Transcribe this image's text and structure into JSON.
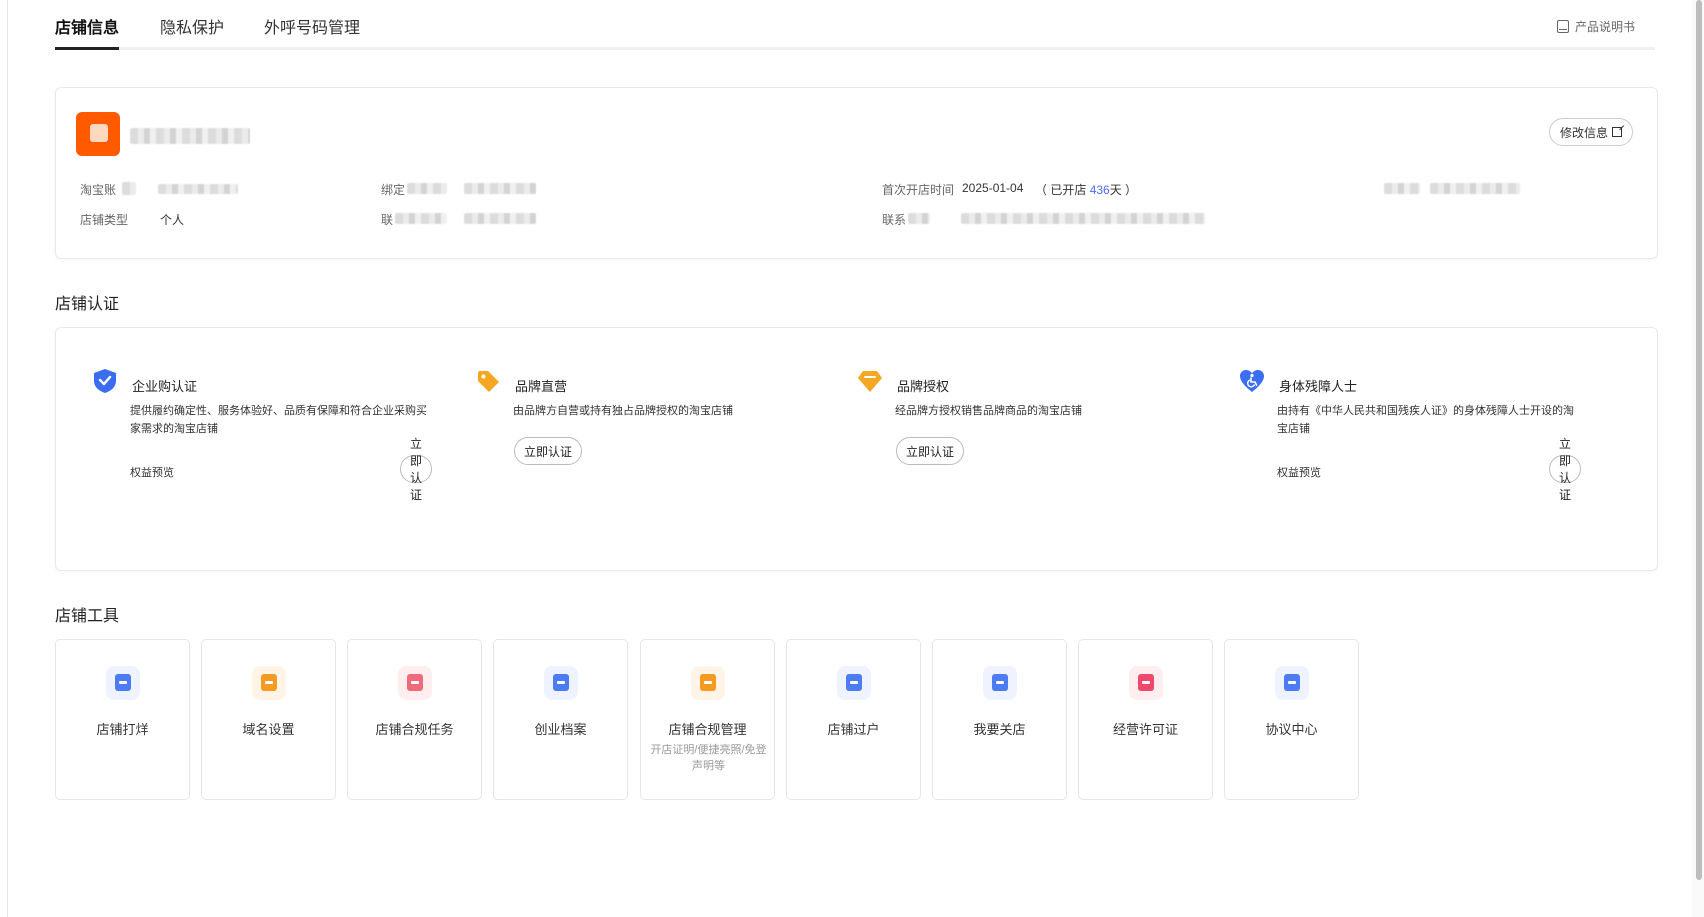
{
  "tabs": [
    {
      "label": "店铺信息",
      "active": true
    },
    {
      "label": "隐私保护",
      "active": false
    },
    {
      "label": "外呼号码管理",
      "active": false
    }
  ],
  "manual_link": "产品说明书",
  "store": {
    "edit_button": "修改信息",
    "fields": {
      "account_label": "淘宝账",
      "bind_label": "绑定",
      "first_open_label": "首次开店时间",
      "first_open_date": "2025-01-04",
      "open_prefix": "（ 已开店",
      "open_days": "436",
      "open_suffix": "天 ）",
      "type_label": "店铺类型",
      "type_value": "个人",
      "contact_label_1": "联",
      "contact_label_2": "联系"
    }
  },
  "cert_section_title": "店铺认证",
  "certs": [
    {
      "title": "企业购认证",
      "desc": "提供履约确定性、服务体验好、品质有保障和符合企业采购买家需求的淘宝店铺",
      "benefit": "权益预览",
      "button": "立即认证",
      "icon": "shield-check-icon",
      "color": "#3a6df0"
    },
    {
      "title": "品牌直营",
      "desc": "由品牌方自营或持有独占品牌授权的淘宝店铺",
      "benefit": "",
      "button": "立即认证",
      "icon": "tag-icon",
      "color": "#f5a623"
    },
    {
      "title": "品牌授权",
      "desc": "经品牌方授权销售品牌商品的淘宝店铺",
      "benefit": "",
      "button": "立即认证",
      "icon": "diamond-icon",
      "color": "#f5a623"
    },
    {
      "title": "身体残障人士",
      "desc": "由持有《中华人民共和国残疾人证》的身体残障人士开设的淘宝店铺",
      "benefit": "权益预览",
      "button": "立即认证",
      "icon": "heart-wheelchair-icon",
      "color": "#3a6df0"
    }
  ],
  "tools_section_title": "店铺工具",
  "tools": [
    {
      "label": "店铺打烊",
      "sub": "",
      "icon": "store-close-icon",
      "color": "#4b7cf3"
    },
    {
      "label": "域名设置",
      "sub": "",
      "icon": "domain-icon",
      "color": "#f59a23"
    },
    {
      "label": "店铺合规任务",
      "sub": "",
      "icon": "compliance-shield-icon",
      "color": "#f06a7b"
    },
    {
      "label": "创业档案",
      "sub": "",
      "icon": "archive-icon",
      "color": "#4b7cf3"
    },
    {
      "label": "店铺合规管理",
      "sub": "开店证明/便捷亮照/免登声明等",
      "icon": "compliance-doc-icon",
      "color": "#f59a23"
    },
    {
      "label": "店铺过户",
      "sub": "",
      "icon": "transfer-icon",
      "color": "#4b7cf3"
    },
    {
      "label": "我要关店",
      "sub": "",
      "icon": "close-store-icon",
      "color": "#4b7cf3"
    },
    {
      "label": "经营许可证",
      "sub": "",
      "icon": "license-icon",
      "color": "#f0476a"
    },
    {
      "label": "协议中心",
      "sub": "",
      "icon": "agreement-icon",
      "color": "#4b7cf3"
    }
  ]
}
